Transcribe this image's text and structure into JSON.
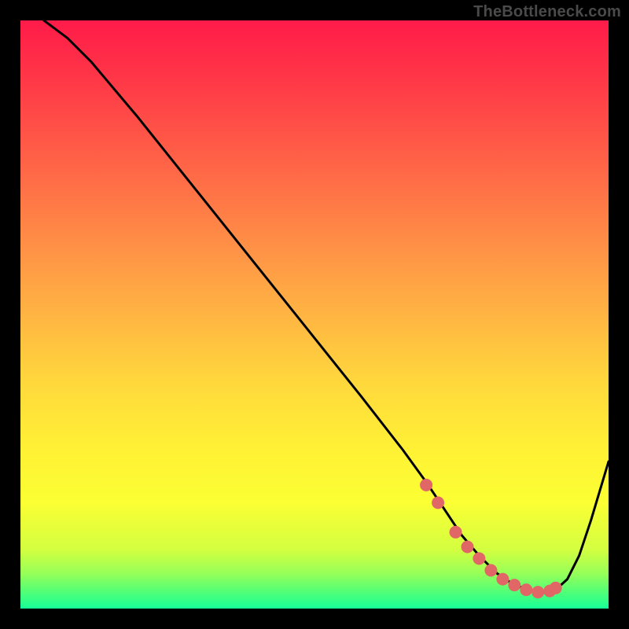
{
  "watermark": "TheBottleneck.com",
  "colors": {
    "frame": "#000000",
    "watermark": "#4a4a4a",
    "curve": "#000000",
    "dots": "#e16666",
    "gradient_stops": [
      {
        "offset": 0.0,
        "color": "#ff1b49"
      },
      {
        "offset": 0.1,
        "color": "#ff3747"
      },
      {
        "offset": 0.28,
        "color": "#ff6f47"
      },
      {
        "offset": 0.45,
        "color": "#ffa545"
      },
      {
        "offset": 0.62,
        "color": "#ffd93c"
      },
      {
        "offset": 0.74,
        "color": "#fff334"
      },
      {
        "offset": 0.82,
        "color": "#fbff33"
      },
      {
        "offset": 0.9,
        "color": "#d3ff40"
      },
      {
        "offset": 0.94,
        "color": "#97ff58"
      },
      {
        "offset": 0.97,
        "color": "#55ff75"
      },
      {
        "offset": 1.0,
        "color": "#17ff98"
      }
    ]
  },
  "chart_data": {
    "type": "line",
    "title": "",
    "xlabel": "",
    "ylabel": "",
    "x_range": [
      0,
      100
    ],
    "y_range": [
      0,
      100
    ],
    "series": [
      {
        "name": "curve",
        "x": [
          4,
          8,
          12,
          20,
          30,
          40,
          50,
          58,
          65,
          69,
          72,
          75,
          78,
          81,
          84,
          87,
          89,
          91,
          93,
          95,
          97,
          100
        ],
        "y": [
          100,
          97,
          93,
          83.5,
          71,
          58.5,
          46,
          36,
          27,
          21.5,
          17,
          12.5,
          9,
          6,
          4,
          3,
          2.7,
          3.2,
          5,
          9,
          15,
          25
        ]
      }
    ],
    "highlight_dots": {
      "name": "optimal-region",
      "x": [
        69,
        71,
        74,
        76,
        78,
        80,
        82,
        84,
        86,
        88,
        90,
        91
      ],
      "y": [
        21,
        18,
        13,
        10.5,
        8.5,
        6.5,
        5,
        4,
        3.2,
        2.8,
        3.0,
        3.5
      ]
    }
  }
}
